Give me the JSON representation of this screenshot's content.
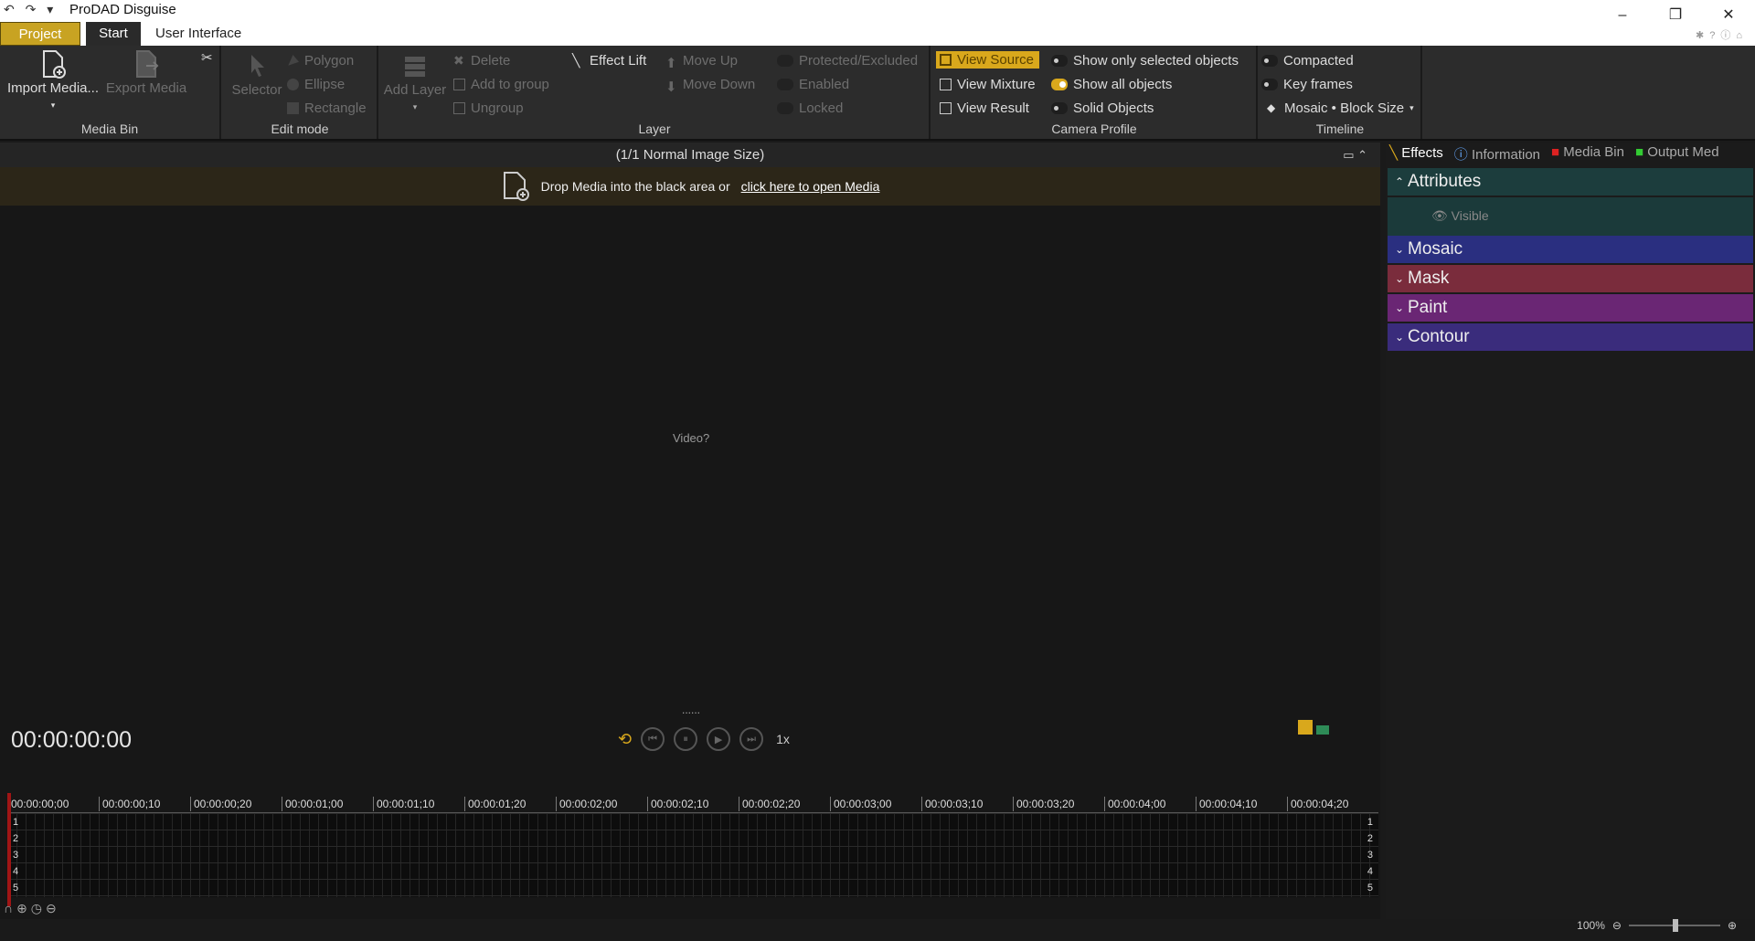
{
  "titlebar": {
    "title": "ProDAD Disguise",
    "quick_access": "↶ ↷ ▾"
  },
  "tabs": {
    "project": "Project",
    "start": "Start",
    "user_interface": "User Interface"
  },
  "ribbon": {
    "media_bin": {
      "label": "Media Bin",
      "import": "Import Media...",
      "export": "Export Media",
      "scissors": "✂"
    },
    "edit_mode": {
      "label": "Edit mode",
      "selector": "Selector",
      "polygon": "Polygon",
      "ellipse": "Ellipse",
      "rectangle": "Rectangle"
    },
    "layer": {
      "label": "Layer",
      "add_layer": "Add Layer",
      "delete": "Delete",
      "add_to_group": "Add to group",
      "ungroup": "Ungroup",
      "effect_lift": "Effect Lift",
      "move_up": "Move Up",
      "move_down": "Move Down",
      "protected": "Protected/Excluded",
      "enabled": "Enabled",
      "locked": "Locked"
    },
    "camera_profile": {
      "label": "Camera Profile",
      "view_source": "View Source",
      "view_mixture": "View Mixture",
      "view_result": "View Result",
      "show_selected": "Show only selected objects",
      "show_all": "Show all objects",
      "solid_objects": "Solid Objects"
    },
    "timeline": {
      "label": "Timeline",
      "compacted": "Compacted",
      "key_frames": "Key frames",
      "mosaic_block": "Mosaic • Block Size"
    }
  },
  "viewer": {
    "header": "(1/1  Normal Image Size)",
    "drop_text": "Drop Media into the black area or",
    "open_link": "click here to open Media",
    "placeholder": "Video?",
    "dots": "......",
    "timecode": "00:00:00:00",
    "speed": "1x"
  },
  "timeline": {
    "ticks": [
      "00:00:00;00",
      "00:00:00;10",
      "00:00:00;20",
      "00:00:01;00",
      "00:00:01;10",
      "00:00:01;20",
      "00:00:02;00",
      "00:00:02;10",
      "00:00:02;20",
      "00:00:03;00",
      "00:00:03;10",
      "00:00:03;20",
      "00:00:04;00",
      "00:00:04;10",
      "00:00:04;20"
    ],
    "tracks": [
      "1",
      "2",
      "3",
      "4",
      "5"
    ]
  },
  "panel": {
    "tabs": {
      "effects": "Effects",
      "information": "Information",
      "media_bin": "Media Bin",
      "output": "Output Med"
    },
    "sections": {
      "attributes": "Attributes",
      "visible": "Visible",
      "mosaic": "Mosaic",
      "mask": "Mask",
      "paint": "Paint",
      "contour": "Contour"
    },
    "colors": {
      "attributes": "#1c3d3d",
      "mosaic": "#2a2f80",
      "mask": "#7a2c3c",
      "paint": "#6a2674",
      "contour": "#3a2c7c"
    }
  },
  "status": {
    "zoom": "100%"
  },
  "colors": {
    "accent": "#d9a81c",
    "playhead": "#a01515"
  }
}
